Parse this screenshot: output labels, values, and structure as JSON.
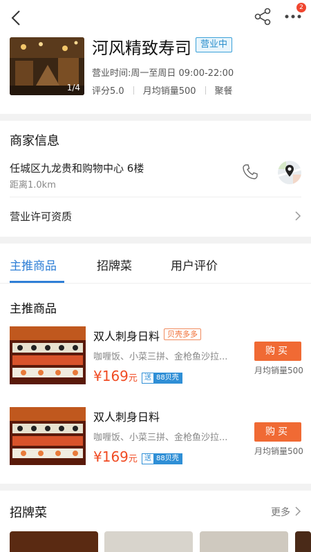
{
  "header": {
    "notification_count": "2",
    "shop_name": "河风精致寿司",
    "status": "营业中",
    "photo_counter": "1/4",
    "hours": "营业时间:周一至周日 09:00-22:00",
    "rating": "评分5.0",
    "monthly_sales": "月均销量500",
    "category": "聚餐"
  },
  "merchant": {
    "title": "商家信息",
    "address": "任城区九龙贵和购物中心 6楼",
    "distance": "距离1.0km",
    "license": "营业许可资质"
  },
  "tabs": [
    "主推商品",
    "招牌菜",
    "用户评价"
  ],
  "products_section": {
    "title": "主推商品",
    "items": [
      {
        "name": "双人刺身日料",
        "tag": "贝壳多多",
        "desc": "咖喱饭、小菜三拼、金枪鱼沙拉...",
        "price": "¥169",
        "price_unit": "元",
        "ship_label": "送",
        "ship_value": "88贝壳",
        "buy_label": "购买",
        "sales": "月均销量500"
      },
      {
        "name": "双人刺身日料",
        "tag": "",
        "desc": "咖喱饭、小菜三拼、金枪鱼沙拉...",
        "price": "¥169",
        "price_unit": "元",
        "ship_label": "送",
        "ship_value": "88贝壳",
        "buy_label": "购买",
        "sales": "月均销量500"
      }
    ]
  },
  "signature": {
    "title": "招牌菜",
    "more": "更多"
  },
  "icons": [
    "back-icon",
    "share-icon",
    "more-icon",
    "phone-icon",
    "map-pin-icon",
    "chevron-right-icon"
  ],
  "colors": {
    "accent_blue": "#2f7fd6",
    "price_red": "#f04b23",
    "buy_orange": "#f06a34",
    "badge_red": "#f0462f"
  }
}
